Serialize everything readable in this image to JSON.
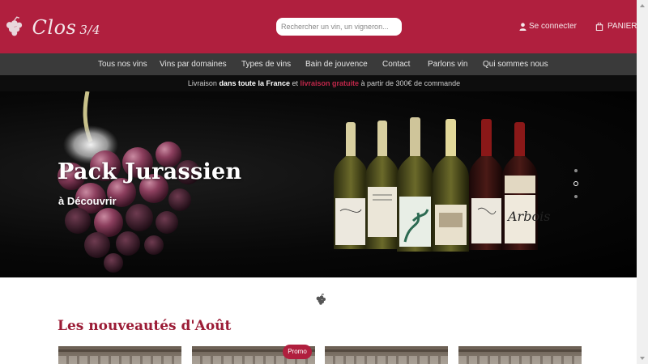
{
  "header": {
    "logo_text": "Clos",
    "logo_fraction": "3/4",
    "search_placeholder": "Rechercher un vin, un vigneron...",
    "account_label": "Se connecter",
    "cart_label": "PANIER"
  },
  "nav": {
    "items": [
      "Tous nos vins",
      "Vins par domaines",
      "Types de vins",
      "Bain de jouvence",
      "Contact",
      "Parlons vin",
      "Qui sommes nous"
    ]
  },
  "infobar": {
    "part1": "Livraison ",
    "part2": "dans toute la France",
    "part3": " et ",
    "part4": "livraison gratuite",
    "part5": " à partir de 300€ de commande"
  },
  "hero": {
    "title": "Pack Jurassien",
    "subtitle": "à Découvrir",
    "bottle_label": "Arbois"
  },
  "section": {
    "title": "Les nouveautés d'Août",
    "promo_label": "Promo"
  },
  "colors": {
    "brand": "#b01f3e",
    "nav_bg": "#3a3a3a",
    "info_bg": "#0d0d0d",
    "section_title": "#9b1c36"
  }
}
